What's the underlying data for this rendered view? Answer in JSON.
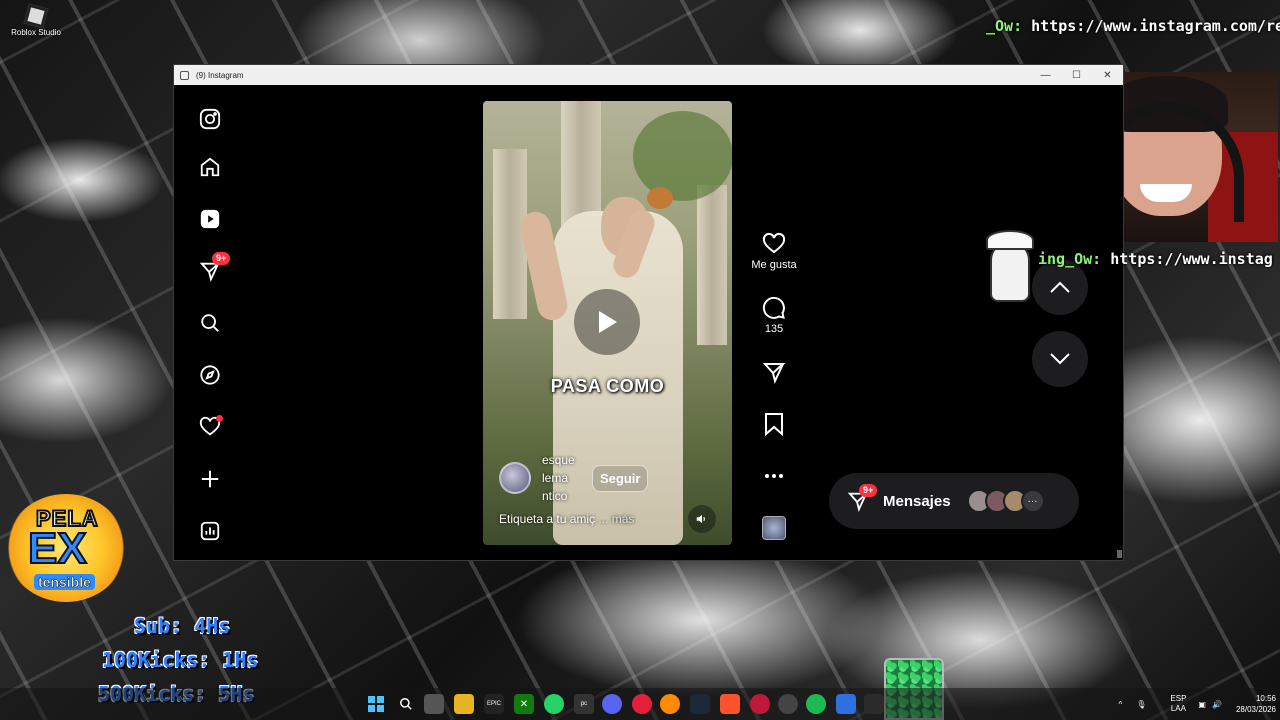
{
  "desktop": {
    "icon_label": "Roblox Studio"
  },
  "overlay": {
    "url_top_nick": "_Ow:",
    "url_top_text": "https://www.instagram.com/re",
    "url_mid_nick": "ing_Ow:",
    "url_mid_text": "https://www.instagr",
    "logo_top": "PELA",
    "logo_mid": "EX",
    "logo_bottom": "tensible",
    "stats": [
      "Sub: 4Hs",
      "100Kicks: 1Hs",
      "500Kicks: 5Hs"
    ]
  },
  "window": {
    "title": "(9) Instagram"
  },
  "sidebar": {
    "notifications_badge": "9+"
  },
  "reel": {
    "caption": "PASA COMO",
    "author_name_lines": [
      "esque",
      "lema",
      "ntico"
    ],
    "follow_label": "Seguir",
    "description": "Etiqueta a tu amiç",
    "more_label": "... más"
  },
  "actions": {
    "like_label": "Me gusta",
    "comments_count": "135"
  },
  "messages": {
    "badge": "9+",
    "label": "Mensajes"
  },
  "taskbar": {
    "lang_top": "ESP",
    "lang_bottom": "LAA",
    "time": "10:56",
    "date": "28/03/2026"
  },
  "colors": {
    "accent_badge": "#ff3040",
    "ig_background": "#000000",
    "pill_background": "#1d1d1f"
  }
}
